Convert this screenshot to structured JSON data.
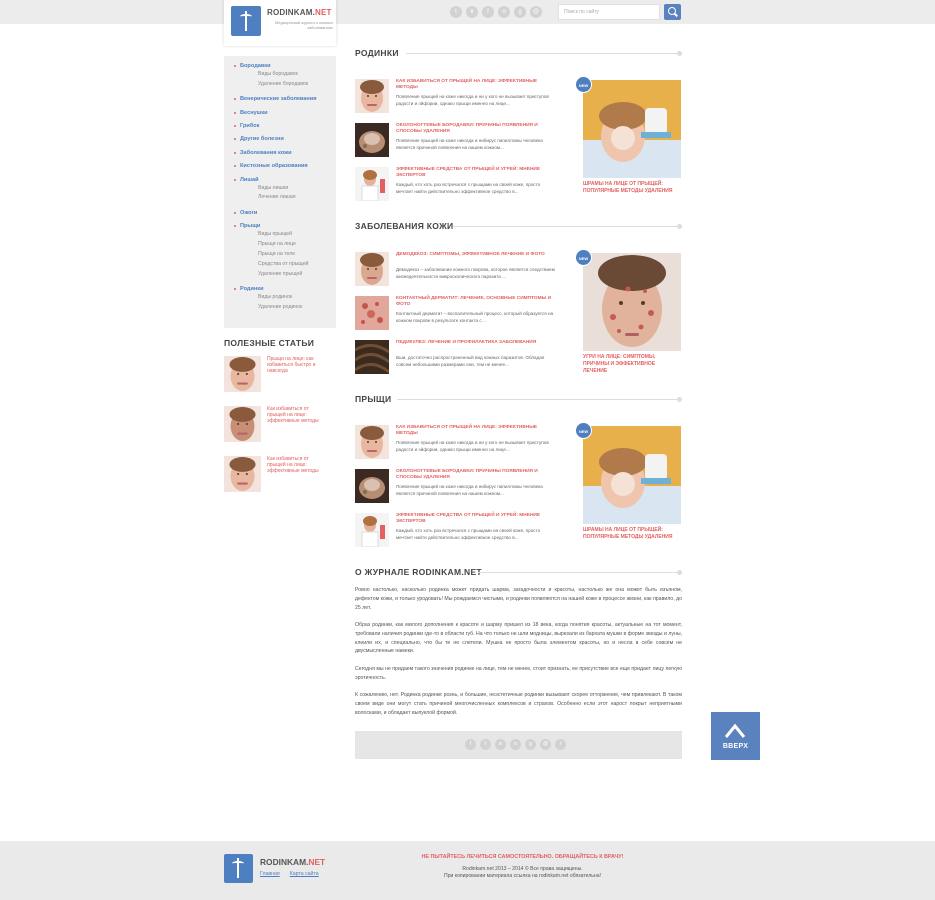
{
  "header": {
    "logo_name": "RODINKAM.",
    "logo_net": "NET",
    "logo_subtitle": "Медицинский журнал о кожных заболеваниях",
    "search_placeholder": "Поиск по сайту",
    "social_icons": [
      "twitter-icon",
      "vk-icon",
      "facebook-icon",
      "odnoklassniki-icon",
      "google-plus-icon",
      "mailru-icon"
    ]
  },
  "sidebar": {
    "categories": [
      {
        "label": "Бородавки",
        "subs": [
          "Виды бородавок",
          "Удаление бородавок"
        ]
      },
      {
        "label": "Венерические заболевания",
        "subs": []
      },
      {
        "label": "Веснушки",
        "subs": []
      },
      {
        "label": "Грибок",
        "subs": []
      },
      {
        "label": "Другие болезни",
        "subs": []
      },
      {
        "label": "Заболевания кожи",
        "subs": []
      },
      {
        "label": "Кистозные образования",
        "subs": []
      },
      {
        "label": "Лишай",
        "subs": [
          "Виды лишая",
          "Лечение лишая"
        ]
      },
      {
        "label": "Ожоги",
        "subs": []
      },
      {
        "label": "Прыщи",
        "subs": [
          "Виды прыщей",
          "Прыщи на лице",
          "Прыщи на теле",
          "Средства от прыщей",
          "Удаление прыщей"
        ]
      },
      {
        "label": "Родинки",
        "subs": [
          "Виды родинок",
          "Удаление родинок"
        ]
      }
    ]
  },
  "useful": {
    "title": "ПОЛЕЗНЫЕ СТАТЬИ",
    "items": [
      "Прыщи на лице: как избавиться быстро и навсегда",
      "Как избавиться от прыщей на лице: эффективные методы",
      "Как избавиться от прыщей на лице: эффективные методы"
    ]
  },
  "sections": [
    {
      "title": "РОДИНКИ",
      "articles": [
        {
          "title": "Как избавиться от прыщей на лице: эффективные методы",
          "desc": "Появление прыщей на коже никогда и ни у кого не вызывает приступов радости и эйфории, однако прыщи именно на лице..."
        },
        {
          "title": "Околоногтевые бородавки: причины появления и способы удаления",
          "desc": "Появление прыщей на коже никогда и нибирус папилломы человека является причиной появления на нашем кожном..."
        },
        {
          "title": "Эффективные средства от прыщей и угрей: мнение экспертов",
          "desc": "Каждый, кто хоть раз встречался с прыщами на своей коже, просто мечтает найти действительно эффективное средство в..."
        }
      ],
      "featured": {
        "badge": "NEW",
        "title": "Шрамы на лице от прыщей: популярные методы удаления"
      }
    },
    {
      "title": "ЗАБОЛЕВАНИЯ КОЖИ",
      "articles": [
        {
          "title": "Демодекоз: симптомы, эффективное лечение и фото",
          "desc": "Демодекоз – заболевание кожного покрова, которое является следствием жизнедеятельности микроскопического паразита ..."
        },
        {
          "title": "Контактный дерматит: лечение, основные симптомы и фото",
          "desc": "Контактный дерматит – воспалительный процесс, который образуется на кожном покрове в результате контакта с ..."
        },
        {
          "title": "Педикулез: лечение и профилактика заболевания",
          "desc": "Вши, достаточно распространенный вид кожных паразитов. Обладая совсем небольшими размерами они, тем не менее..."
        }
      ],
      "featured": {
        "badge": "NEW",
        "title": "Угри на лице: симптомы, причины и эффективное лечение"
      }
    },
    {
      "title": "ПРЫЩИ",
      "articles": [
        {
          "title": "Как избавиться от прыщей на лице: эффективные методы",
          "desc": "Появление прыщей на коже никогда и ни у кого не вызывает приступов радости и эйфории, однако прыщи именно на лице..."
        },
        {
          "title": "Околоногтевые бородавки: причины появления и способы удаления",
          "desc": "Появление прыщей на коже никогда и нибирус папилломы человека является причиной появления на нашем кожном..."
        },
        {
          "title": "Эффективные средства от прыщей и угрей: мнение экспертов",
          "desc": "Каждый, кто хоть раз встречался с прыщами на своей коже, просто мечтает найти действительно эффективное средство в..."
        }
      ],
      "featured": {
        "badge": "NEW",
        "title": "Шрамы на лице от прыщей: популярные методы удаления"
      }
    }
  ],
  "about": {
    "title": "О ЖУРНАЛЕ RODINKAM.NET",
    "paragraphs": [
      "Ровно настолько, насколько родинка может придать шарма, загадочности и красоты, настолько же она может быть изъяном, дефектом кожи, и только уродовать! Мы рождаемся чистыми, и родинки появляются на нашей коже в процессе жизни, как правило, до 25 лет.",
      "Образ родинки, как милого дополнения к красоте и шарму пришел из 18 века, когда понятия красоты, актуальные на тот момент, требовали наличия родинки где-то в области губ. На что только не шли модницы, вырезали из бархата мушки в форме звезды и луны, клеили их, и специально, что бы те не слетели. Мушка не просто была элементом красоты, но и несла в себе совсем не двусмысленные намеки.",
      "Сегодня мы не придаем такого значения родинке на лице, тем не менее, стоит признать, ее присутствие все еще придает лицу легкую эротичность.",
      "К сожалению, нет. Родинка родинке рознь, и большие, неэстетичные родинки вызывают скорее отторжение, чем привлекают. В таком своем виде они могут стать причиной многочисленных комплексов и страхов. Особенно если этот нарост покрыт неприятными волосками, и обладает выпуклой формой."
    ]
  },
  "up_button": {
    "label": "ВВЕРХ"
  },
  "footer": {
    "logo_name": "RODINKAM.",
    "logo_net": "NET",
    "links": [
      "Главная",
      "Карта сайта"
    ],
    "warning": "НЕ ПЫТАЙТЕСЬ ЛЕЧИТЬСЯ САМОСТОЯТЕЛЬНО. ОБРАЩАЙТЕСЬ К ВРАЧУ!",
    "copyright": "Rodinkam.net 2013 – 2014 © Все права защищены.",
    "copy_note": "При копировании материала ссылка на rodinkam.net обязательна!"
  },
  "colors": {
    "accent_red": "#e26060",
    "brand_blue": "#4d7fc1",
    "button_blue": "#5a82bf",
    "bg_grey": "#ececec"
  }
}
